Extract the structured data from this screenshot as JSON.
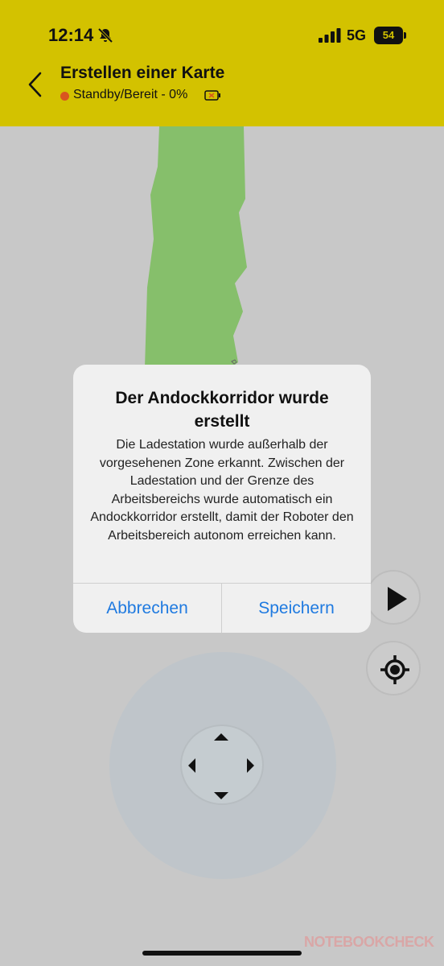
{
  "status_bar": {
    "time": "12:14",
    "network": "5G",
    "battery_level": "54"
  },
  "header": {
    "title": "Erstellen einer Karte",
    "status": "Standby/Bereit - 0%",
    "status_color": "#d9551f",
    "background": "#d3c200"
  },
  "map": {
    "area_color": "#86bf6b",
    "background": "#c8c8c8"
  },
  "controls": {
    "play_icon": "play-icon",
    "locate_icon": "crosshair-icon",
    "joystick_icons": [
      "arrow-up-icon",
      "arrow-down-icon",
      "arrow-left-icon",
      "arrow-right-icon"
    ]
  },
  "dialog": {
    "title": "Der Andockkorridor wurde erstellt",
    "message": "Die Ladestation wurde außerhalb der vorgesehenen Zone erkannt. Zwischen der Ladestation und der Grenze des Arbeitsbereichs wurde automatisch ein Andockkorridor erstellt, damit der Roboter den Arbeitsbereich autonom erreichen kann.",
    "cancel_label": "Abbrechen",
    "save_label": "Speichern",
    "button_color": "#1f7ae0"
  },
  "watermark": "NOTEBOOKCHECK"
}
